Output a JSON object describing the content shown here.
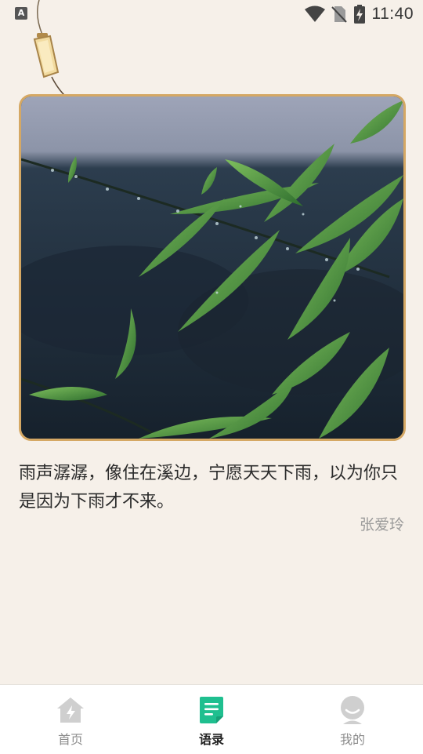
{
  "status_bar": {
    "time": "11:40",
    "left_icon": "A",
    "icons": [
      "wifi-icon",
      "no-sim-icon",
      "battery-charging-icon"
    ]
  },
  "quote": {
    "text": "雨声潺潺，像住在溪边，宁愿天天下雨，以为你只是因为下雨才不来。",
    "author": "张爱玲"
  },
  "bottom_nav": {
    "items": [
      {
        "label": "首页",
        "icon": "home-lightning-icon",
        "active": false
      },
      {
        "label": "语录",
        "icon": "note-list-icon",
        "active": true
      },
      {
        "label": "我的",
        "icon": "profile-avatar-icon",
        "active": false
      }
    ]
  },
  "colors": {
    "background": "#f6f0e9",
    "card_border": "#d5a864",
    "accent_green": "#1fbf8f",
    "inactive_icon": "#cfcfcf"
  }
}
